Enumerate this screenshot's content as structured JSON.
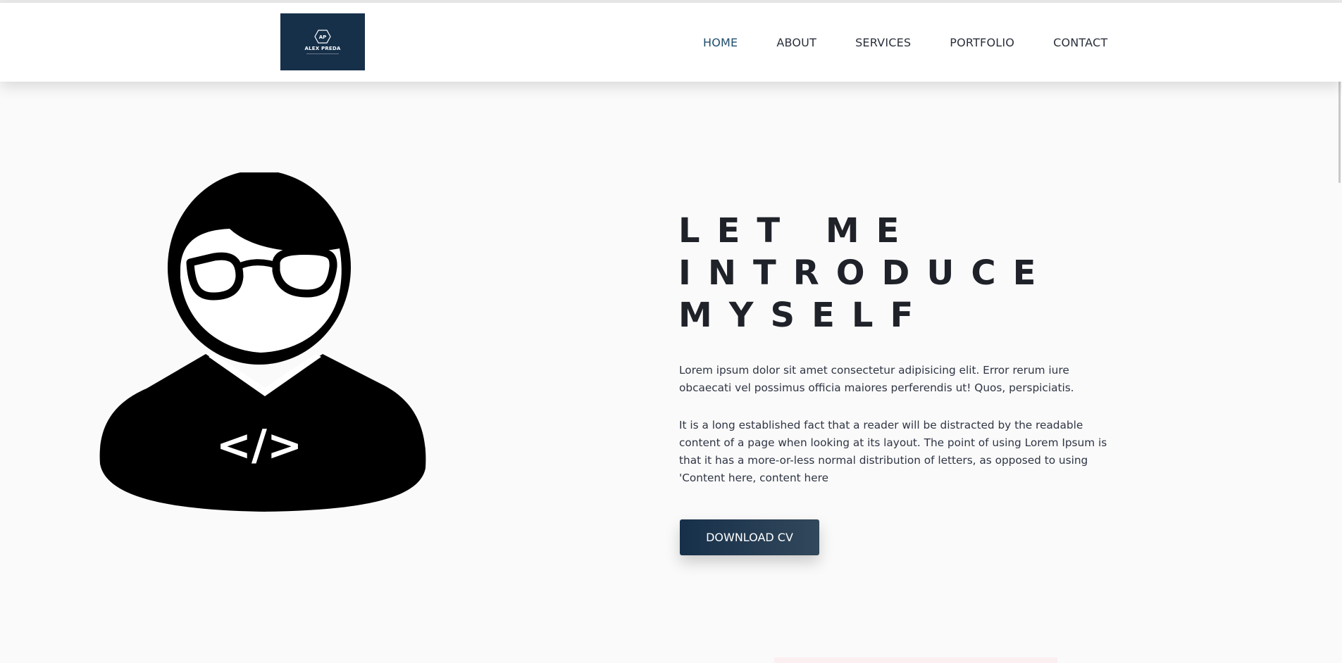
{
  "brand": {
    "logo_initials": "AP",
    "logo_name": "ALEX PREDA",
    "logo_bg": "#16304a"
  },
  "nav": {
    "items": [
      {
        "label": "HOME",
        "active": true
      },
      {
        "label": "ABOUT",
        "active": false
      },
      {
        "label": "SERVICES",
        "active": false
      },
      {
        "label": "PORTFOLIO",
        "active": false
      },
      {
        "label": "CONTACT",
        "active": false
      }
    ],
    "active_color": "#1f4d6b"
  },
  "hero": {
    "avatar_icon": "developer-avatar-icon",
    "avatar_code_glyph": "</>",
    "title_lines": [
      "LET ME",
      "INTRODUCE",
      "MYSELF"
    ],
    "paragraph_1": "Lorem ipsum dolor sit amet consectetur adipisicing elit. Error rerum iure obcaecati vel possimus officia maiores perferendis ut! Quos, perspiciatis.",
    "paragraph_2": "It is a long established fact that a reader will be distracted by the readable content of a page when looking at its layout. The point of using Lorem Ipsum is that it has a more-or-less normal distribution of letters, as opposed to using 'Content here, content here",
    "cta_label": "DOWNLOAD CV",
    "cta_colors": [
      "#17304a",
      "#32485b"
    ]
  }
}
